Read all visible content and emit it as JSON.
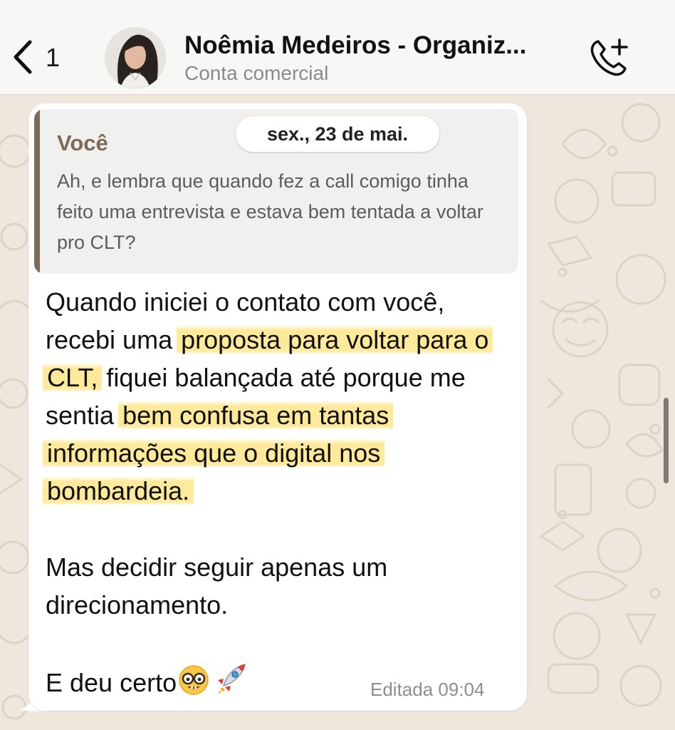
{
  "header": {
    "back_count": "1",
    "contact_name": "Noêmia Medeiros - Organiz...",
    "contact_subtitle": "Conta comercial"
  },
  "date_pill": "sex., 23 de mai.",
  "quote": {
    "author": "Você",
    "text": "Ah, e lembra que quando fez a call comigo tinha feito uma entrevista e estava bem tentada a voltar pro CLT?"
  },
  "message": {
    "p1_a": "Quando iniciei o contato com você, recebi uma ",
    "p1_hl1": "proposta para voltar para o CLT,",
    "p1_b": " fiquei balançada até porque me sentia ",
    "p1_hl2": "bem confusa em tantas informações que o digital nos bombardeia.",
    "p2": "Mas decidir seguir apenas um direcionamento.",
    "p3": "E deu certo",
    "emojis": [
      "nerd-face",
      "rocket"
    ]
  },
  "meta": "Editada 09:04",
  "colors": {
    "quote_accent": "#7b6b57",
    "highlight": "#ffe278",
    "wallpaper": "#efe7dd"
  },
  "icons": [
    "chevron-left-icon",
    "phone-add-icon"
  ]
}
